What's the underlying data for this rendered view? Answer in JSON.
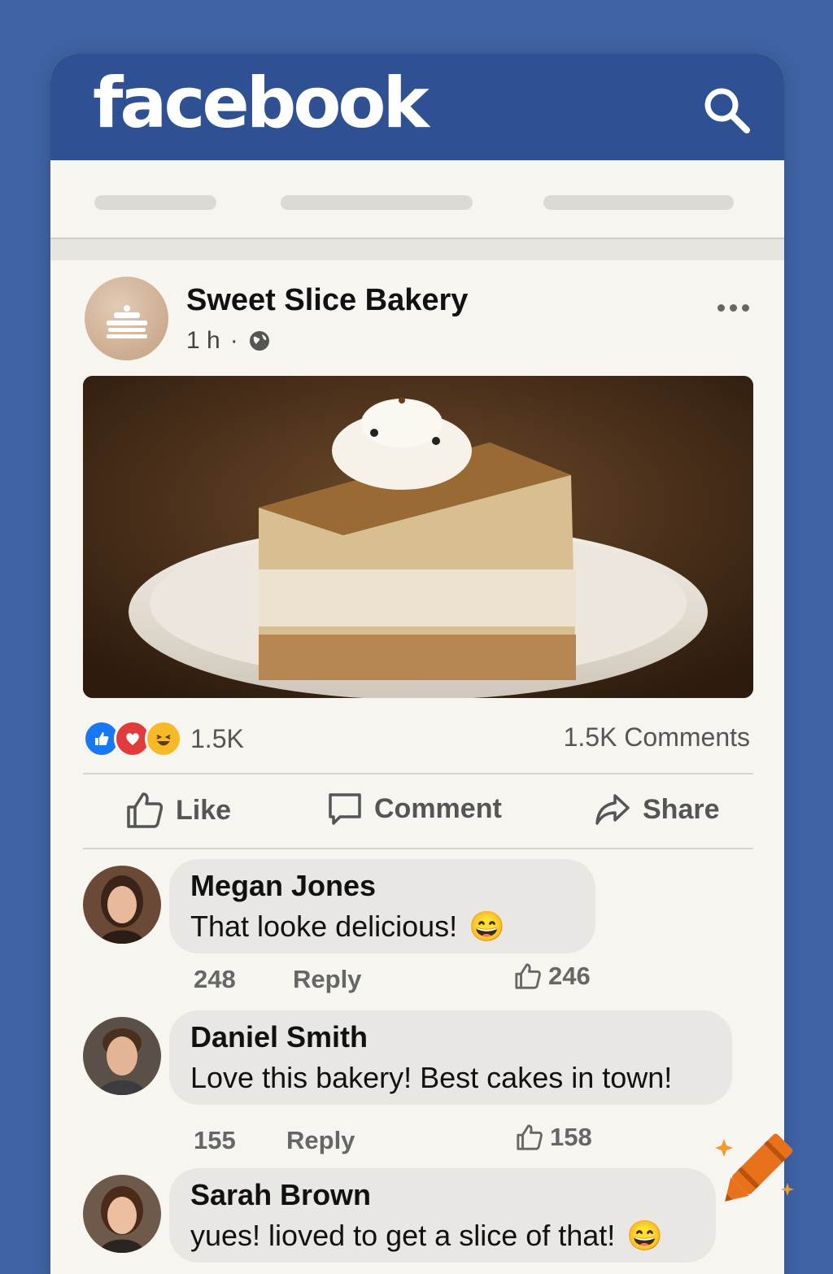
{
  "app": {
    "logo_text": "facebook"
  },
  "colors": {
    "brand": "#2f5193",
    "background": "#3f62a3",
    "like_blue": "#1877f2",
    "love_red": "#e23b3b",
    "haha_yellow": "#f7b928"
  },
  "header": {
    "search_icon": "search-icon"
  },
  "post": {
    "page_name": "Sweet Slice Bakery",
    "time": "1 h",
    "separator": "·",
    "privacy_icon": "globe-icon",
    "reaction_count": "1.5K",
    "comments_count": "1.5K Comments",
    "actions": {
      "like": "Like",
      "comment": "Comment",
      "share": "Share"
    }
  },
  "comments": [
    {
      "name": "Megan Jones",
      "text": "That looke delicious!",
      "emoji": "😄",
      "count": "248",
      "reply": "Reply",
      "likes": "246"
    },
    {
      "name": "Daniel Smith",
      "text": "Love this bakery! Best cakes in town!",
      "emoji": "",
      "count": "155",
      "reply": "Reply",
      "likes": "158"
    },
    {
      "name": "Sarah Brown",
      "text": "yues! lioved to get a slice of that!",
      "emoji": "😄",
      "count": "",
      "reply": "",
      "likes": ""
    }
  ]
}
